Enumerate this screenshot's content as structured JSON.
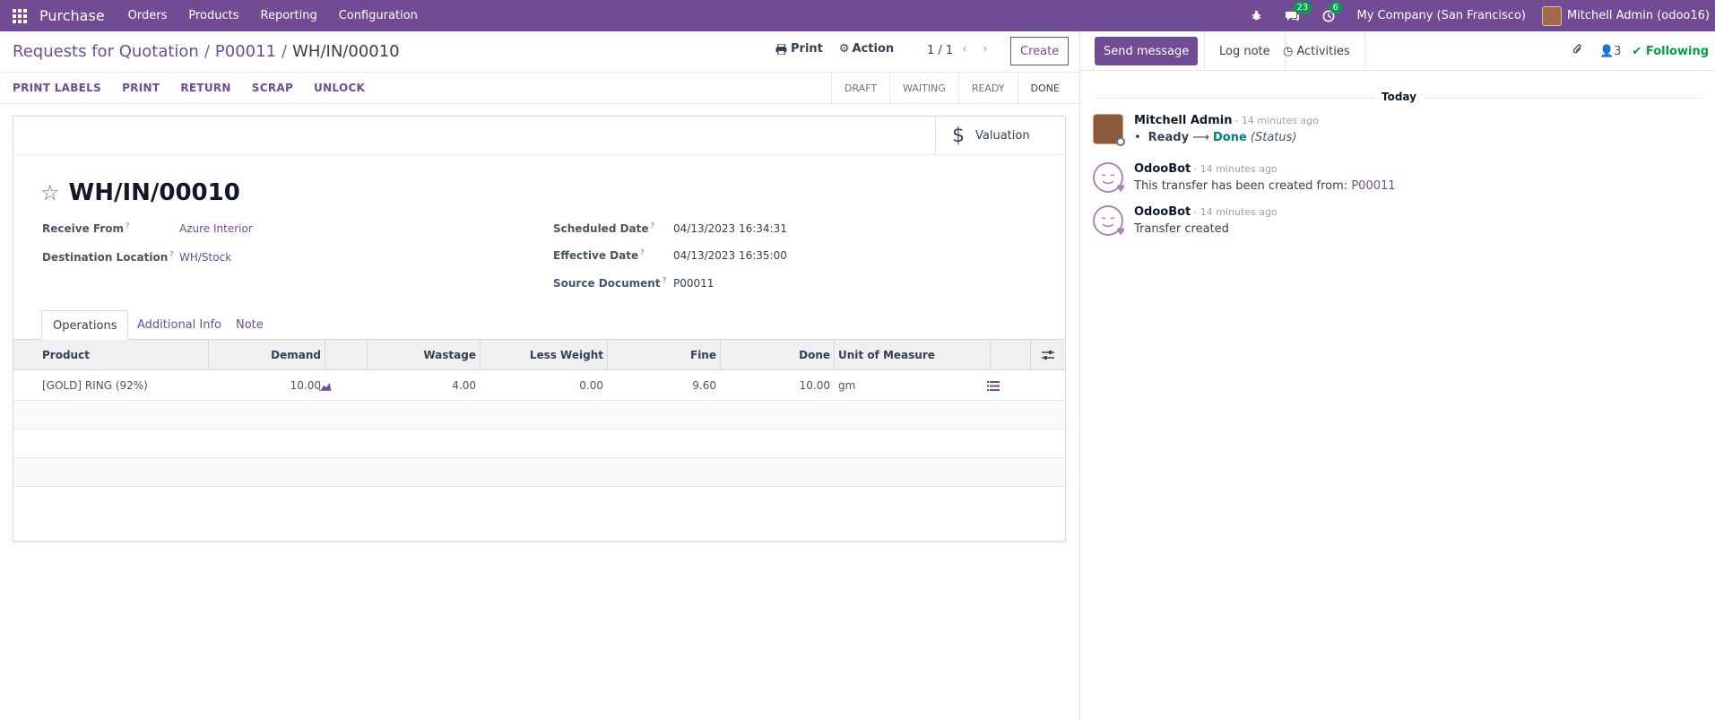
{
  "navbar": {
    "app_name": "Purchase",
    "menus": [
      "Orders",
      "Products",
      "Reporting",
      "Configuration"
    ],
    "messages_count": "23",
    "activities_count": "6",
    "company": "My Company (San Francisco)",
    "user": "Mitchell Admin (odoo16)"
  },
  "breadcrumb": {
    "items": [
      "Requests for Quotation",
      "P00011"
    ],
    "current": "WH/IN/00010"
  },
  "control_panel": {
    "print_label": "Print",
    "action_label": "Action",
    "pager": "1 / 1",
    "create_label": "Create"
  },
  "header_buttons": [
    "PRINT LABELS",
    "PRINT",
    "RETURN",
    "SCRAP",
    "UNLOCK"
  ],
  "statusbar": {
    "stages": [
      "DRAFT",
      "WAITING",
      "READY",
      "DONE"
    ],
    "active": "DONE"
  },
  "smart_buttons": {
    "valuation": "Valuation"
  },
  "record": {
    "name": "WH/IN/00010",
    "fields_left": [
      {
        "label": "Receive From",
        "value": "Azure Interior"
      },
      {
        "label": "Destination Location",
        "value": "WH/Stock"
      }
    ],
    "fields_right": [
      {
        "label": "Scheduled Date",
        "value": "04/13/2023 16:34:31"
      },
      {
        "label": "Effective Date",
        "value": "04/13/2023 16:35:00"
      },
      {
        "label": "Source Document",
        "value": "P00011"
      }
    ]
  },
  "tabs": [
    "Operations",
    "Additional Info",
    "Note"
  ],
  "table": {
    "columns": [
      "Product",
      "Demand",
      "Wastage",
      "Less Weight",
      "Fine",
      "Done",
      "Unit of Measure"
    ],
    "rows": [
      {
        "product": "[GOLD] RING (92%)",
        "demand": "10.00",
        "wastage": "4.00",
        "less_weight": "0.00",
        "fine": "9.60",
        "done": "10.00",
        "uom": "gm"
      }
    ]
  },
  "chatter": {
    "send_message": "Send message",
    "log_note": "Log note",
    "activities": "Activities",
    "followers_count": "3",
    "following": "Following",
    "date_separator": "Today",
    "messages": [
      {
        "author": "Mitchell Admin",
        "date": "- 14 minutes ago",
        "tracking_old": "Ready",
        "tracking_new": "Done",
        "tracking_field": "(Status)"
      },
      {
        "author": "OdooBot",
        "date": "- 14 minutes ago",
        "body": "This transfer has been created from:",
        "link": "P00011"
      },
      {
        "author": "OdooBot",
        "date": "- 14 minutes ago",
        "body": "Transfer created"
      }
    ]
  },
  "colors": {
    "brand": "#714b94",
    "success": "#00a04a",
    "tracking_new": "#017e84"
  }
}
